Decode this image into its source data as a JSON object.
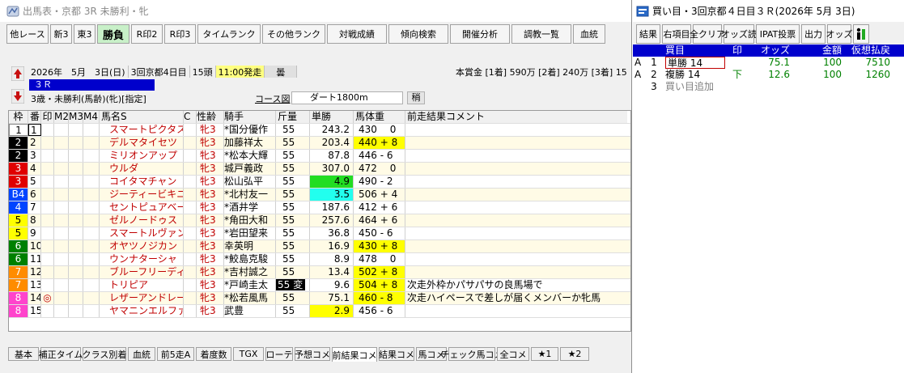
{
  "left": {
    "title": "出馬表・京都 3R 未勝利・牝",
    "toolbar": [
      "他レース",
      "新3",
      "東3",
      "勝負",
      "R印2",
      "R印3",
      "タイムランク",
      "その他ランク",
      "対戦成績",
      "傾向検索",
      "開催分析",
      "調教一覧",
      "血統"
    ],
    "race": {
      "date": "2026年　5月　3日(日)",
      "meet": "3回京都4日目",
      "heads": "15頭",
      "start": "11:00発走",
      "weather": "曇",
      "number": "３Ｒ",
      "condition": "3歳・未勝利(馬齢)(牝)[指定]",
      "course_label": "コース図",
      "course": "ダート1800m",
      "going": "稍",
      "prize": "本賞金 [1着] 590万 [2着] 240万 [3着] 15"
    },
    "columns": [
      "枠",
      "番",
      "印",
      "M2",
      "M3",
      "M4",
      "馬名S",
      "C",
      "性齢",
      "騎手",
      "斤量",
      "単勝",
      "馬体重",
      "前走結果コメント"
    ],
    "waku_colors": {
      "1": {
        "bg": "#ffffff",
        "fg": "#000000"
      },
      "2": {
        "bg": "#000000",
        "fg": "#ffffff"
      },
      "3": {
        "bg": "#e00000",
        "fg": "#ffffff"
      },
      "4": {
        "bg": "#0044ff",
        "fg": "#ffffff"
      },
      "5": {
        "bg": "#ffff00",
        "fg": "#000000"
      },
      "6": {
        "bg": "#008000",
        "fg": "#ffffff"
      },
      "7": {
        "bg": "#ff8c00",
        "fg": "#ffffff"
      },
      "8": {
        "bg": "#ff44cc",
        "fg": "#ffffff"
      }
    },
    "rows": [
      {
        "waku": "1",
        "waku_label": "1",
        "ban": "1",
        "mark": "",
        "name": "スマートピクタス",
        "sex": "牝3",
        "jockey": "*国分優作",
        "kin": "55",
        "odds": "243.2",
        "bw": "430　 0",
        "cmt": "",
        "odds_bg": "",
        "bw_bg": "",
        "kin_badge": false,
        "kin_extra": ""
      },
      {
        "waku": "2",
        "waku_label": "2",
        "ban": "2",
        "mark": "",
        "name": "デルマタイセツ",
        "sex": "牝3",
        "jockey": " 加藤祥太",
        "kin": "55",
        "odds": "203.4",
        "bw": "440 + 8",
        "cmt": "",
        "odds_bg": "",
        "bw_bg": "#ffff00",
        "kin_badge": false,
        "kin_extra": ""
      },
      {
        "waku": "2",
        "waku_label": "2",
        "ban": "3",
        "mark": "",
        "name": "ミリオンアップ",
        "sex": "牝3",
        "jockey": "*松本大輝",
        "kin": "55",
        "odds": "87.8",
        "bw": "446 - 6",
        "cmt": "",
        "odds_bg": "",
        "bw_bg": "",
        "kin_badge": false,
        "kin_extra": ""
      },
      {
        "waku": "3",
        "waku_label": "3",
        "ban": "4",
        "mark": "",
        "name": "ウルダ",
        "sex": "牝3",
        "jockey": " 城戸義政",
        "kin": "55",
        "odds": "307.0",
        "bw": "472　 0",
        "cmt": "",
        "odds_bg": "",
        "bw_bg": "",
        "kin_badge": false,
        "kin_extra": ""
      },
      {
        "waku": "3",
        "waku_label": "3",
        "ban": "5",
        "mark": "",
        "name": "コイタマチャン",
        "sex": "牝3",
        "jockey": " 松山弘平",
        "kin": "55",
        "odds": "4.9",
        "bw": "490 - 2",
        "cmt": "",
        "odds_bg": "#22dd22",
        "bw_bg": "",
        "kin_badge": false,
        "kin_extra": ""
      },
      {
        "waku": "4",
        "waku_label": "B4",
        "ban": "6",
        "mark": "",
        "name": "ジーティービキニ",
        "sex": "牝3",
        "jockey": "*北村友一",
        "kin": "55",
        "odds": "3.5",
        "bw": "506 + 4",
        "cmt": "",
        "odds_bg": "#22ffee",
        "bw_bg": "",
        "kin_badge": false,
        "kin_extra": ""
      },
      {
        "waku": "4",
        "waku_label": "4",
        "ban": "7",
        "mark": "",
        "name": "セントピュアベース",
        "sex": "牝3",
        "jockey": "*酒井学",
        "kin": "55",
        "odds": "187.6",
        "bw": "412 + 6",
        "cmt": "",
        "odds_bg": "",
        "bw_bg": "",
        "kin_badge": false,
        "kin_extra": ""
      },
      {
        "waku": "5",
        "waku_label": "5",
        "ban": "8",
        "mark": "",
        "name": "ゼルノードゥス",
        "sex": "牝3",
        "jockey": "*角田大和",
        "kin": "55",
        "odds": "257.6",
        "bw": "464 + 6",
        "cmt": "",
        "odds_bg": "",
        "bw_bg": "",
        "kin_badge": false,
        "kin_extra": ""
      },
      {
        "waku": "5",
        "waku_label": "5",
        "ban": "9",
        "mark": "",
        "name": "スマートルヴァン",
        "sex": "牝3",
        "jockey": "*岩田望来",
        "kin": "55",
        "odds": "36.8",
        "bw": "450 - 6",
        "cmt": "",
        "odds_bg": "",
        "bw_bg": "",
        "kin_badge": false,
        "kin_extra": ""
      },
      {
        "waku": "6",
        "waku_label": "6",
        "ban": "10",
        "mark": "",
        "name": "オヤツノジカン",
        "sex": "牝3",
        "jockey": " 幸英明",
        "kin": "55",
        "odds": "16.9",
        "bw": "430 + 8",
        "cmt": "",
        "odds_bg": "",
        "bw_bg": "#ffff00",
        "kin_badge": false,
        "kin_extra": ""
      },
      {
        "waku": "6",
        "waku_label": "6",
        "ban": "11",
        "mark": "",
        "name": "ウンナターシャ",
        "sex": "牝3",
        "jockey": "*鮫島克駿",
        "kin": "55",
        "odds": "8.9",
        "bw": "478　 0",
        "cmt": "",
        "odds_bg": "",
        "bw_bg": "",
        "kin_badge": false,
        "kin_extra": ""
      },
      {
        "waku": "7",
        "waku_label": "7",
        "ban": "12",
        "mark": "",
        "name": "ブルーフリーディン",
        "sex": "牝3",
        "jockey": "*吉村誠之",
        "kin": "55",
        "odds": "13.4",
        "bw": "502 + 8",
        "cmt": "",
        "odds_bg": "",
        "bw_bg": "#ffff00",
        "kin_badge": false,
        "kin_extra": ""
      },
      {
        "waku": "7",
        "waku_label": "7",
        "ban": "13",
        "mark": "",
        "name": "トリピア",
        "sex": "牝3",
        "jockey": "*戸崎圭太",
        "kin": "55",
        "odds": "9.6",
        "bw": "504 + 8",
        "cmt": "次走外枠かパサパサの良馬場で",
        "odds_bg": "",
        "bw_bg": "#ffff00",
        "kin_badge": true,
        "kin_extra": "変"
      },
      {
        "waku": "8",
        "waku_label": "8",
        "ban": "14",
        "mark": "◎",
        "name": "レザーアンドレース",
        "sex": "牝3",
        "jockey": "*松若風馬",
        "kin": "55",
        "odds": "75.1",
        "bw": "460 - 8",
        "cmt": "次走ハイペースで差しが届くメンバーか牝馬",
        "odds_bg": "",
        "bw_bg": "#ffff00",
        "kin_badge": false,
        "kin_extra": ""
      },
      {
        "waku": "8",
        "waku_label": "8",
        "ban": "15",
        "mark": "",
        "name": "ヤマニンエルファバ",
        "sex": "牝3",
        "jockey": " 武豊",
        "kin": "55",
        "odds": "2.9",
        "bw": "456 - 6",
        "cmt": "",
        "odds_bg": "#ffff00",
        "bw_bg": "",
        "kin_badge": false,
        "kin_extra": ""
      }
    ],
    "bottom_tabs": [
      "基本",
      "補正タイム",
      "クラス別着",
      "血統",
      "前5走A",
      "着度数",
      "TGX",
      "ローテ",
      "予想コメ",
      "前結果コメ",
      "結果コメ",
      "馬コメ",
      "チェック馬コメ",
      "全コメ",
      "★1",
      "★2"
    ],
    "active_tab": "前結果コメ"
  },
  "right": {
    "title": "買い目・3回京都４日目３Ｒ(2026年 5月 3日)",
    "toolbar": [
      "結果",
      "右項目",
      "全クリア",
      "オッズ読",
      "IPAT投票",
      "出力",
      "オッズ"
    ],
    "columns": {
      "type": "買目",
      "mark": "印",
      "odds": "オッズ",
      "amount": "金額",
      "payout": "仮想払戻"
    },
    "bets": [
      {
        "a": "A",
        "n": "1",
        "type": "単勝 14",
        "mark": "",
        "odds": "75.1",
        "amount": "100",
        "payout": "7510"
      },
      {
        "a": "A",
        "n": "2",
        "type": "複勝 14",
        "mark": "下",
        "odds": "12.6",
        "amount": "100",
        "payout": "1260"
      },
      {
        "a": "",
        "n": "3",
        "type": "買い目追加",
        "mark": "",
        "odds": "",
        "amount": "",
        "payout": ""
      }
    ]
  }
}
